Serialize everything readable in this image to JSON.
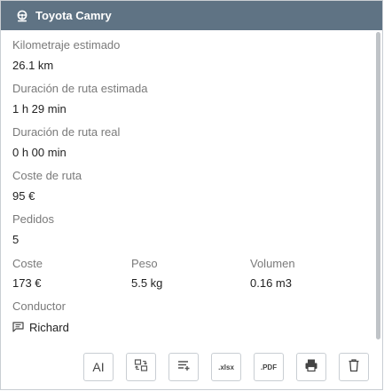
{
  "header": {
    "title": "Toyota Camry",
    "icon": "steering-wheel-icon"
  },
  "fields": {
    "km_label": "Kilometraje estimado",
    "km_value": "26.1 km",
    "est_dur_label": "Duración de ruta estimada",
    "est_dur_value": "1 h 29 min",
    "real_dur_label": "Duración de ruta real",
    "real_dur_value": "0 h 00 min",
    "cost_route_label": "Coste de ruta",
    "cost_route_value": "95 €",
    "orders_label": "Pedidos",
    "orders_value": "5",
    "cost_label": "Coste",
    "cost_value": "173 €",
    "weight_label": "Peso",
    "weight_value": "5.5 kg",
    "volume_label": "Volumen",
    "volume_value": "0.16 m3",
    "driver_label": "Conductor",
    "driver_value": "Richard"
  },
  "toolbar": {
    "ai_label": "AI",
    "xlsx_label": ".xlsx",
    "pdf_label": ".PDF"
  }
}
